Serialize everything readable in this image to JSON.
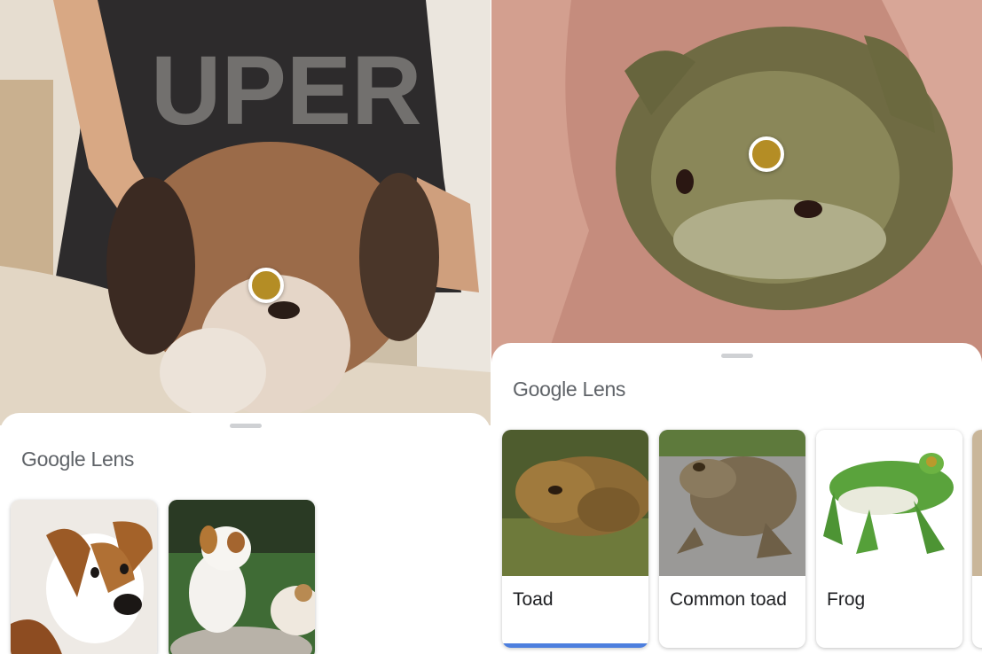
{
  "left_panel": {
    "brand": "Google Lens",
    "results": [
      {
        "label": "",
        "image": "jack-russell-puppy-portrait"
      },
      {
        "label": "",
        "image": "puppy-on-grass"
      }
    ]
  },
  "right_panel": {
    "brand": "Google Lens",
    "results": [
      {
        "label": "Toad",
        "image": "toad-on-moss",
        "selected": true
      },
      {
        "label": "Common toad",
        "image": "common-toad"
      },
      {
        "label": "Frog",
        "image": "green-tree-frog"
      }
    ]
  },
  "colors": {
    "focus_dot": "#b48d25",
    "selected_underline": "#4d7fde"
  }
}
